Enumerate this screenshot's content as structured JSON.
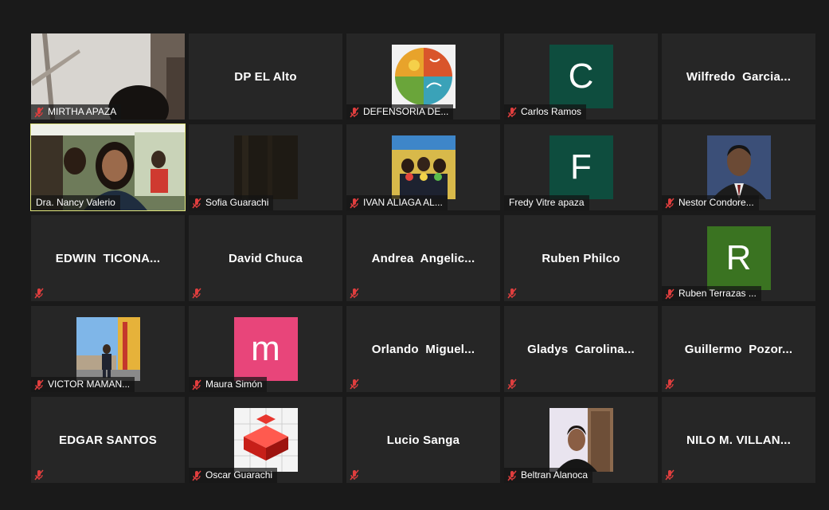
{
  "colors": {
    "background": "#1a1a1a",
    "tile": "#262626",
    "active_border": "#e2e77e",
    "mute": "#e03e3e"
  },
  "participants": [
    {
      "label": "MIRTHA APAZA",
      "type": "video"
    },
    {
      "big_name": "DP EL Alto",
      "type": "name-only-no-label"
    },
    {
      "label": "DEFENSORIA DE...",
      "type": "picture"
    },
    {
      "label": "Carlos Ramos",
      "type": "avatar",
      "initial": "C",
      "avatar_color": "#0e4d3e"
    },
    {
      "big_name": "Wilfredo  Garcia...",
      "type": "name-only-no-label"
    },
    {
      "label": "Dra. Nancy Valerio",
      "type": "video",
      "active": true,
      "muted": false
    },
    {
      "label": "Sofia Guarachi",
      "type": "picture"
    },
    {
      "label": "IVAN ALIAGA AL...",
      "type": "picture"
    },
    {
      "label": "Fredy Vitre apaza",
      "type": "avatar",
      "initial": "F",
      "avatar_color": "#0e4d3e",
      "muted": false
    },
    {
      "label": "Nestor Condore...",
      "type": "picture"
    },
    {
      "big_name": "EDWIN  TICONA...",
      "type": "name-only"
    },
    {
      "big_name": "David Chuca",
      "type": "name-only"
    },
    {
      "big_name": "Andrea  Angelic...",
      "type": "name-only"
    },
    {
      "big_name": "Ruben Philco",
      "type": "name-only"
    },
    {
      "label": "Ruben Terrazas ...",
      "type": "avatar",
      "initial": "R",
      "avatar_color": "#3a7321"
    },
    {
      "label": "VICTOR MAMAN...",
      "type": "picture"
    },
    {
      "label": "Maura Simón",
      "type": "avatar",
      "initial": "m",
      "avatar_color": "#e8457a"
    },
    {
      "big_name": "Orlando  Miguel...",
      "type": "name-only"
    },
    {
      "big_name": "Gladys  Carolina...",
      "type": "name-only"
    },
    {
      "big_name": "Guillermo  Pozor...",
      "type": "name-only"
    },
    {
      "big_name": "EDGAR SANTOS",
      "type": "name-only"
    },
    {
      "label": "Oscar Guarachi",
      "type": "picture"
    },
    {
      "big_name": "Lucio Sanga",
      "type": "name-only"
    },
    {
      "label": "Beltran Alanoca",
      "type": "picture"
    },
    {
      "big_name": "NILO M. VILLAN...",
      "type": "name-only"
    }
  ]
}
